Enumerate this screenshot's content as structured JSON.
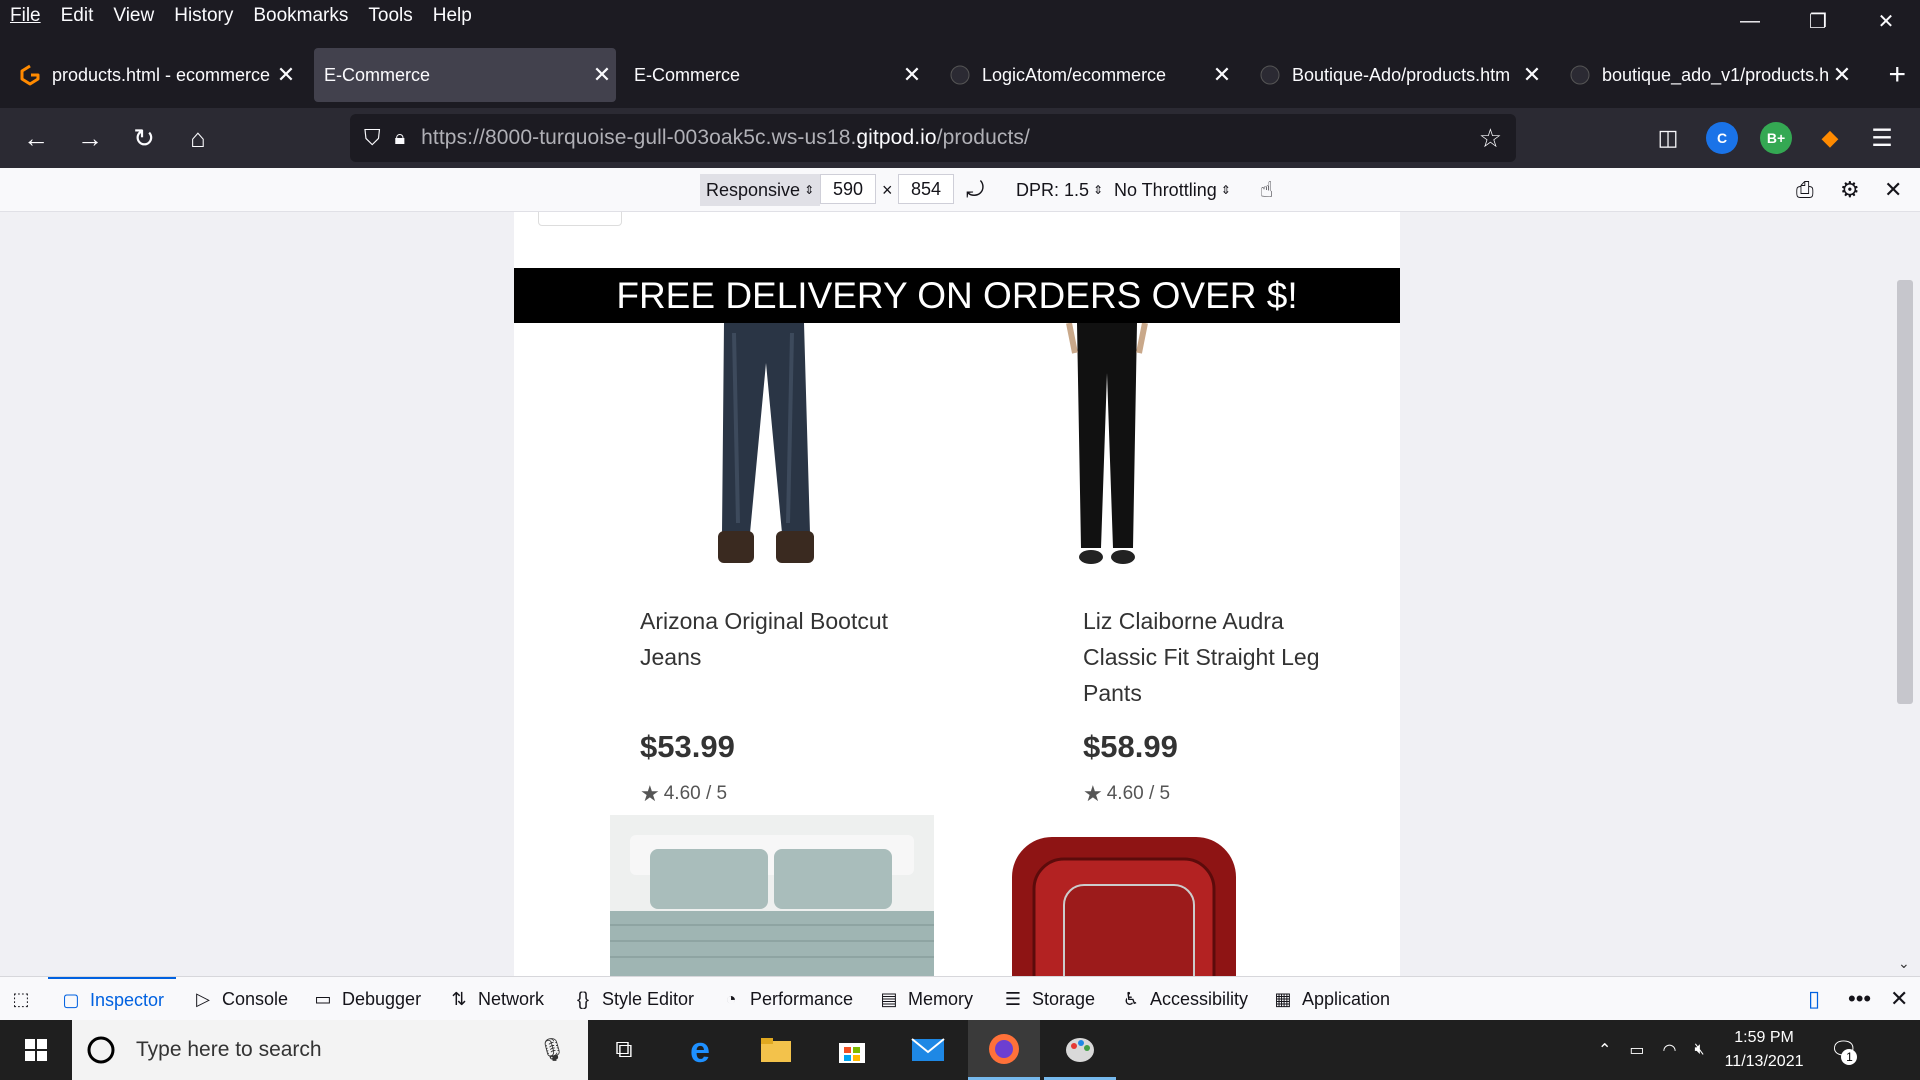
{
  "menubar": {
    "items": [
      "File",
      "Edit",
      "View",
      "History",
      "Bookmarks",
      "Tools",
      "Help"
    ]
  },
  "tabs": [
    {
      "title": "products.html - ecommerce",
      "icon": "gitpod-icon",
      "active": false
    },
    {
      "title": "E-Commerce",
      "icon": "",
      "active": true
    },
    {
      "title": "E-Commerce",
      "icon": "",
      "active": false
    },
    {
      "title": "LogicAtom/ecommerce",
      "icon": "github-icon",
      "active": false
    },
    {
      "title": "Boutique-Ado/products.htm",
      "icon": "github-icon",
      "active": false
    },
    {
      "title": "boutique_ado_v1/products.h",
      "icon": "github-icon",
      "active": false
    }
  ],
  "url": {
    "prefix": "https://8000-turquoise-gull-003oak5c.ws-us18.",
    "domain": "gitpod.io",
    "path": "/products/"
  },
  "rdm": {
    "device": "Responsive",
    "width": "590",
    "separator": "×",
    "height": "854",
    "dpr": "DPR: 1.5",
    "throttling": "No Throttling"
  },
  "page": {
    "banner": "FREE DELIVERY ON ORDERS OVER $!",
    "products": [
      {
        "name_line1": "Arizona Original Bootcut",
        "name_line2": "Jeans",
        "name_line3": "",
        "price": "$53.99",
        "rating": "4.60 / 5"
      },
      {
        "name_line1": "Liz Claiborne Audra",
        "name_line2": "Classic Fit Straight Leg",
        "name_line3": "Pants",
        "price": "$58.99",
        "rating": "4.60 / 5"
      }
    ]
  },
  "devtools": {
    "tabs": [
      "Inspector",
      "Console",
      "Debugger",
      "Network",
      "Style Editor",
      "Performance",
      "Memory",
      "Storage",
      "Accessibility",
      "Application"
    ]
  },
  "taskbar": {
    "search_placeholder": "Type here to search",
    "time": "1:59 PM",
    "date": "11/13/2021",
    "notification_count": "1"
  },
  "colors": {
    "banner_bg": "#000000",
    "active_devtools": "#0061e0",
    "browser_dark": "#1c1b22"
  }
}
